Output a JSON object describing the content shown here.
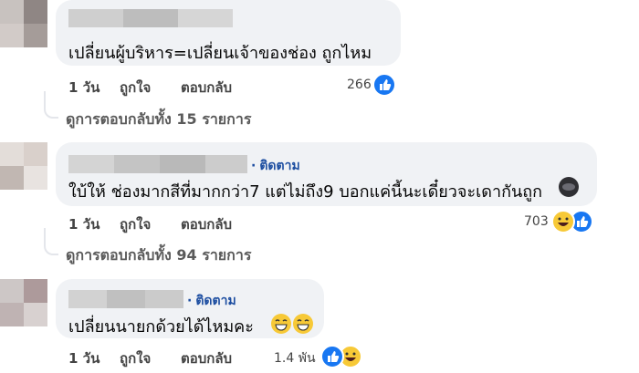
{
  "comments": [
    {
      "follow_label": "",
      "text": "เปลี่ยนผู้บริหาร=เปลี่ยนเจ้าของช่อง ถูกไหม",
      "time": "1 วัน",
      "like_label": "ถูกใจ",
      "reply_label": "ตอบกลับ",
      "reaction_count": "266",
      "reactions": [
        "like-icon"
      ],
      "view_replies": "ดูการตอบกลับทั้ง 15 รายการ"
    },
    {
      "follow_label": "ติดตาม",
      "text": "ใบ้ให้ ช่องมากสีที่มากกว่า7 แต่ไม่ถึง9 บอกแค่นี้นะเดี๋ยวจะเดากันถูก",
      "time": "1 วัน",
      "like_label": "ถูกใจ",
      "reply_label": "ตอบกลับ",
      "reaction_count": "703",
      "reactions": [
        "haha-icon",
        "like-icon"
      ],
      "view_replies": "ดูการตอบกลับทั้ง 94 รายการ"
    },
    {
      "follow_label": "ติดตาม",
      "text": "เปลี่ยนนายกด้วยได้ไหมคะ",
      "time": "1 วัน",
      "like_label": "ถูกใจ",
      "reply_label": "ตอบกลับ",
      "reaction_count": "1.4 พัน",
      "reactions": [
        "like-icon",
        "haha-icon"
      ],
      "view_replies": ""
    }
  ],
  "colors": {
    "bubble": "#f0f2f5",
    "follow": "#1d4ea1",
    "like_blue": "#1877f2",
    "haha_yellow": "#f7c937"
  }
}
